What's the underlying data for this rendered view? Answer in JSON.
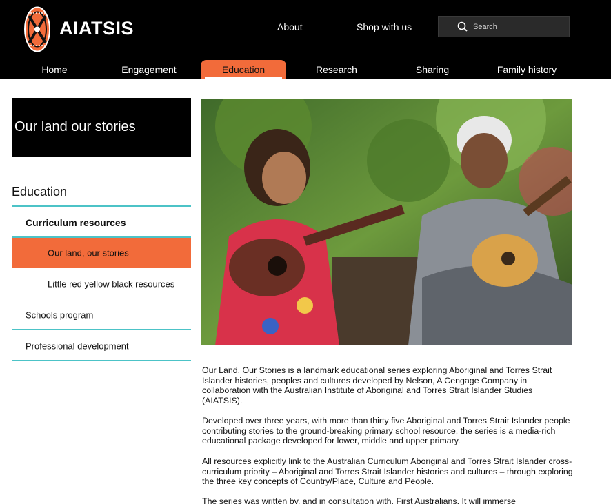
{
  "header": {
    "brand": "AIATSIS",
    "top_links": [
      "About",
      "Shop with us"
    ],
    "search": {
      "placeholder": "Search"
    }
  },
  "nav": {
    "items": [
      "Home",
      "Engagement",
      "Education",
      "Research",
      "Sharing",
      "Family history"
    ],
    "active": "Education"
  },
  "sidebar": {
    "title": "Our land our stories",
    "heading": "Education",
    "items": [
      {
        "label": "Curriculum resources",
        "level": 1,
        "bold": true
      },
      {
        "label": "Our land, our stories",
        "level": 2,
        "active": true
      },
      {
        "label": "Little red yellow black resources",
        "level": 2
      },
      {
        "label": "Schools program",
        "level": 1
      },
      {
        "label": "Professional development",
        "level": 1
      }
    ]
  },
  "content": {
    "paragraphs": [
      "Our Land, Our Stories is a landmark educational series exploring Aboriginal and Torres Strait Islander histories, peoples and cultures developed by Nelson, A Cengage Company in collaboration with the Australian Institute of Aboriginal and Torres Strait Islander Studies (AIATSIS).",
      "Developed over three years, with more than thirty five Aboriginal and Torres Strait Islander people contributing stories to the ground-breaking primary school resource, the series is a media-rich educational package developed for lower, middle and upper primary.",
      "All resources explicitly link to the Australian Curriculum Aboriginal and Torres Strait Islander cross-curriculum priority – Aboriginal and Torres Strait Islander histories and cultures – through exploring the three key concepts of Country/Place, Culture and People.",
      "The series was written by, and in consultation with, First Australians. It will immerse"
    ]
  },
  "colors": {
    "accent": "#f26b3a",
    "rule": "#4cc3c7",
    "header_bg": "#000000"
  }
}
